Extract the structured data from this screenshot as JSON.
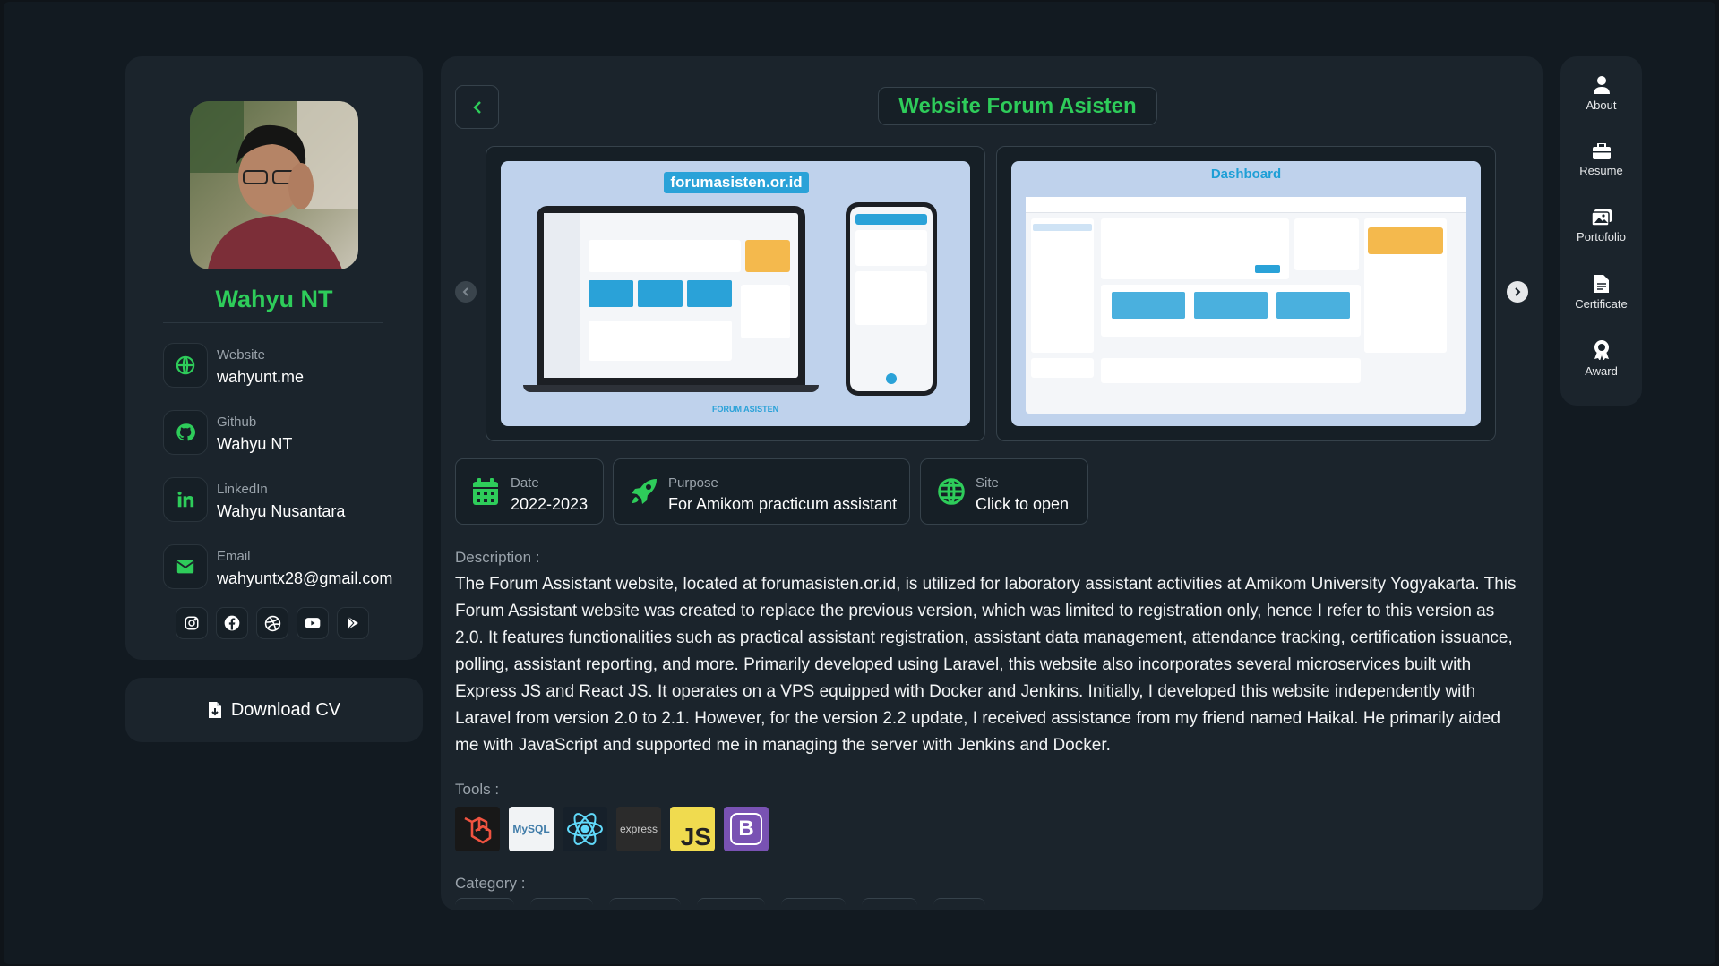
{
  "profile": {
    "name": "Wahyu NT",
    "contacts": [
      {
        "label": "Website",
        "value": "wahyunt.me",
        "icon": "globe-icon"
      },
      {
        "label": "Github",
        "value": "Wahyu NT",
        "icon": "github-icon"
      },
      {
        "label": "LinkedIn",
        "value": "Wahyu Nusantara",
        "icon": "linkedin-icon"
      },
      {
        "label": "Email",
        "value": "wahyuntx28@gmail.com",
        "icon": "email-icon"
      }
    ],
    "socials": [
      "instagram-icon",
      "facebook-icon",
      "dribbble-icon",
      "youtube-icon",
      "play-store-icon"
    ]
  },
  "download": {
    "label": "Download CV"
  },
  "project": {
    "title": "Website Forum Asisten",
    "slides": [
      {
        "caption": "forumasisten.or.id",
        "footer": "FORUM ASISTEN"
      },
      {
        "caption": "Dashboard"
      }
    ],
    "info": [
      {
        "label": "Date",
        "value": "2022-2023",
        "icon": "calendar-icon"
      },
      {
        "label": "Purpose",
        "value": "For Amikom practicum assistant",
        "icon": "rocket-icon"
      },
      {
        "label": "Site",
        "value": "Click to open",
        "icon": "globe-icon"
      }
    ],
    "description_label": "Description :",
    "description": "The Forum Assistant website, located at forumasisten.or.id, is utilized for laboratory assistant activities at Amikom University Yogyakarta. This Forum Assistant website was created to replace the previous version, which was limited to registration only, hence I refer to this version as 2.0. It features functionalities such as practical assistant registration, assistant data management, attendance tracking, certification issuance, polling, assistant reporting, and more. Primarily developed using Laravel, this website also incorporates several microservices built with Express JS and React JS. It operates on a VPS equipped with Docker and Jenkins. Initially, I developed this website independently with Laravel from version 2.0 to 2.1. However, for the version 2.2 update, I received assistance from my friend named Haikal. He primarily aided me with JavaScript and supported me in managing the server with Jenkins and Docker.",
    "tools_label": "Tools :",
    "tools": [
      {
        "name": "laravel-icon",
        "text": ""
      },
      {
        "name": "mysql-icon",
        "text": "MySQL"
      },
      {
        "name": "react-icon",
        "text": ""
      },
      {
        "name": "express-icon",
        "text": "express"
      },
      {
        "name": "javascript-icon",
        "text": "JS"
      },
      {
        "name": "bootstrap-icon",
        "text": "B"
      }
    ],
    "category_label": "Category :"
  },
  "nav": [
    {
      "label": "About",
      "icon": "user-icon"
    },
    {
      "label": "Resume",
      "icon": "briefcase-icon"
    },
    {
      "label": "Portofolio",
      "icon": "images-icon"
    },
    {
      "label": "Certificate",
      "icon": "file-icon"
    },
    {
      "label": "Award",
      "icon": "award-icon"
    }
  ],
  "colors": {
    "accent": "#2ecc5a",
    "card": "#1b242c",
    "background": "#0f1419"
  }
}
